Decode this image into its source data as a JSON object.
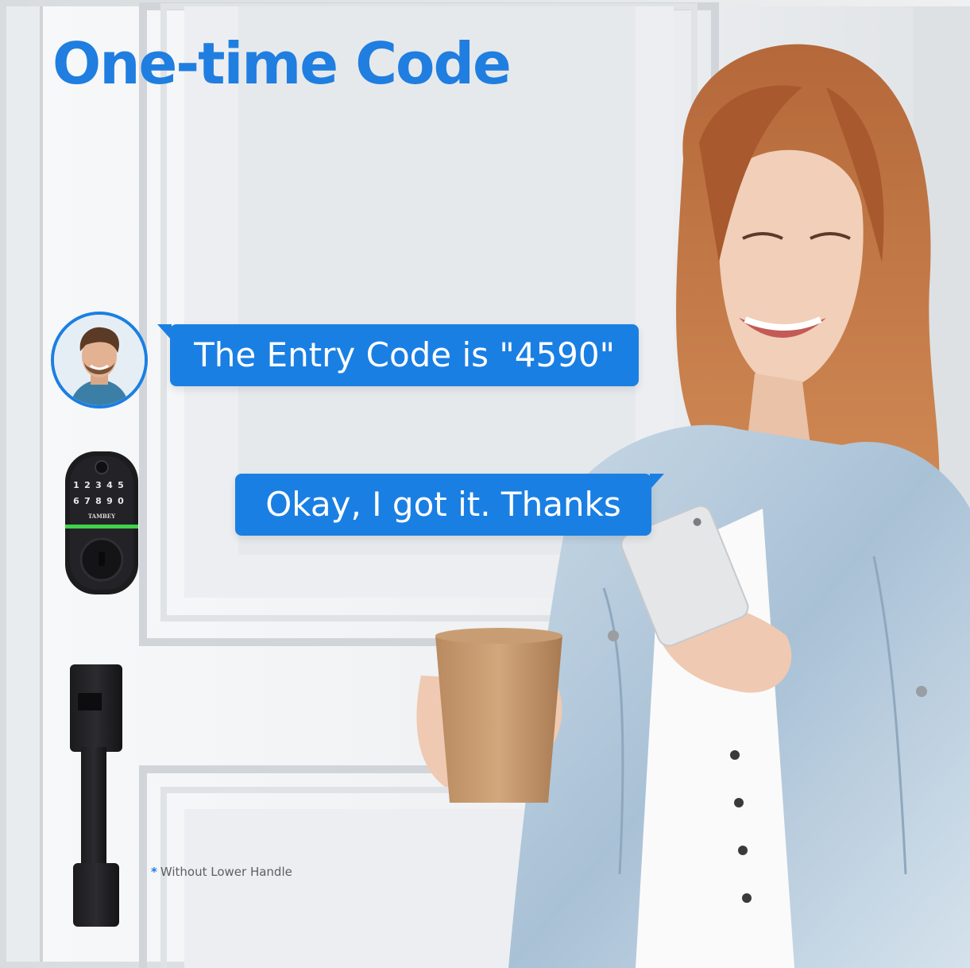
{
  "headline": "One-time Code",
  "chat": {
    "message_1": "The Entry Code is \"4590\"",
    "message_2": "Okay, I got it. Thanks"
  },
  "lock": {
    "brand": "TAMBEY",
    "keypad_row_1": [
      "1",
      "2",
      "3",
      "4",
      "5"
    ],
    "keypad_row_2": [
      "6",
      "7",
      "8",
      "9",
      "0"
    ]
  },
  "footnote": {
    "marker": "*",
    "text": "Without Lower Handle"
  },
  "colors": {
    "accent_blue": "#1a7fe3",
    "headline_blue": "#1f7ee0",
    "status_light_green": "#3fd24a"
  }
}
